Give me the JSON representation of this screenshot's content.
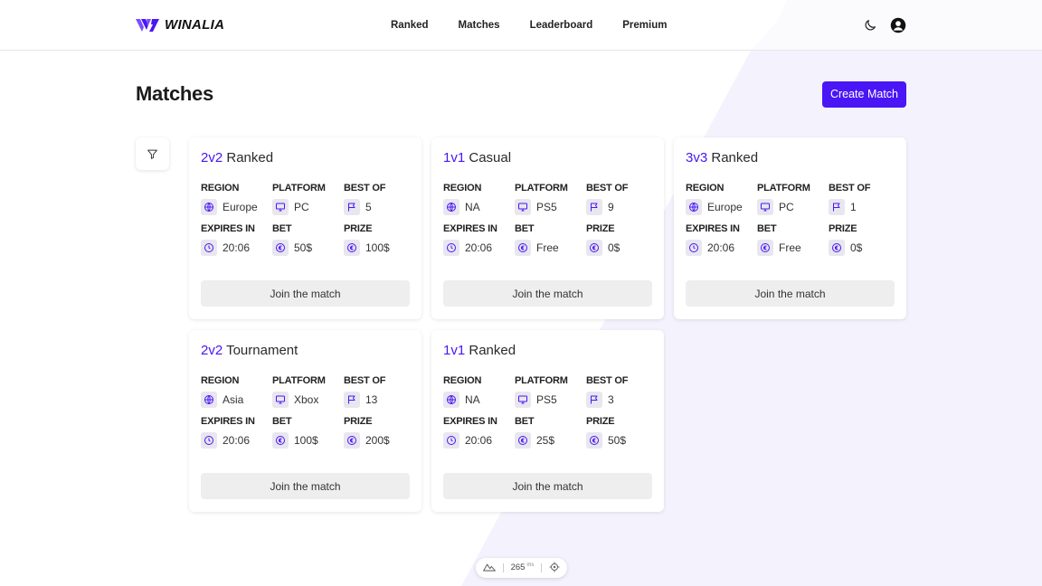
{
  "brand": {
    "name": "WINALIA",
    "accent": "#4a16f5"
  },
  "nav": [
    {
      "label": "Ranked"
    },
    {
      "label": "Matches"
    },
    {
      "label": "Leaderboard"
    },
    {
      "label": "Premium"
    }
  ],
  "header_icons": [
    "moon-icon",
    "user-account-icon"
  ],
  "page": {
    "title": "Matches",
    "create_label": "Create Match"
  },
  "field_labels": {
    "region": "REGION",
    "platform": "PLATFORM",
    "best_of": "BEST OF",
    "expires_in": "EXPIRES IN",
    "bet": "BET",
    "prize": "PRIZE"
  },
  "join_label": "Join the match",
  "matches": [
    {
      "mode": "2v2",
      "type": "Ranked",
      "region": "Europe",
      "platform": "PC",
      "best_of": "5",
      "expires_in": "20:06",
      "bet": "50$",
      "prize": "100$"
    },
    {
      "mode": "1v1",
      "type": "Casual",
      "region": "NA",
      "platform": "PS5",
      "best_of": "9",
      "expires_in": "20:06",
      "bet": "Free",
      "prize": "0$"
    },
    {
      "mode": "3v3",
      "type": "Ranked",
      "region": "Europe",
      "platform": "PC",
      "best_of": "1",
      "expires_in": "20:06",
      "bet": "Free",
      "prize": "0$"
    },
    {
      "mode": "2v2",
      "type": "Tournament",
      "region": "Asia",
      "platform": "Xbox",
      "best_of": "13",
      "expires_in": "20:06",
      "bet": "100$",
      "prize": "200$"
    },
    {
      "mode": "1v1",
      "type": "Ranked",
      "region": "NA",
      "platform": "PS5",
      "best_of": "3",
      "expires_in": "20:06",
      "bet": "25$",
      "prize": "50$"
    }
  ],
  "status": {
    "latency": "265",
    "unit": "ms"
  }
}
